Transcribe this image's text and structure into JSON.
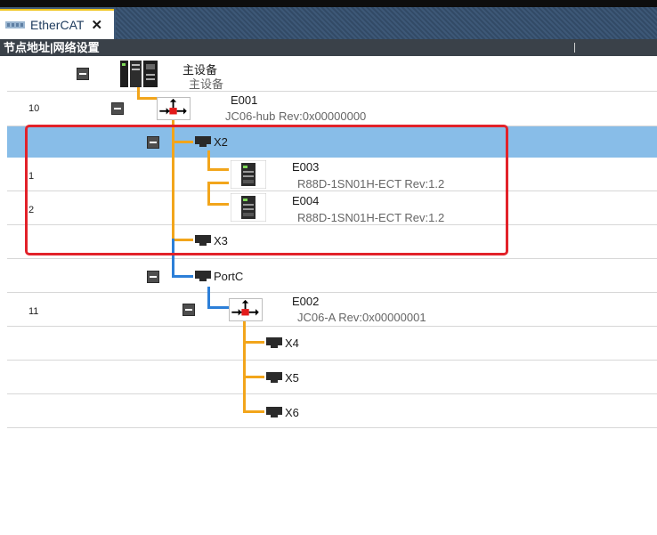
{
  "tab": {
    "title": "EtherCAT",
    "close": "✕"
  },
  "header": {
    "column_label": "节点地址|网络设置"
  },
  "master": {
    "name": "主设备",
    "subtitle": "主设备"
  },
  "nodes": {
    "e001": {
      "address": "10",
      "name": "E001",
      "model": "JC06-hub Rev:0x00000000"
    },
    "e003": {
      "address": "1",
      "name": "E003",
      "model": "R88D-1SN01H-ECT Rev:1.2"
    },
    "e004": {
      "address": "2",
      "name": "E004",
      "model": "R88D-1SN01H-ECT Rev:1.2"
    },
    "e002": {
      "address": "11",
      "name": "E002",
      "model": "JC06-A Rev:0x00000001"
    }
  },
  "ports": {
    "x2": "X2",
    "x3": "X3",
    "portc": "PortC",
    "x4": "X4",
    "x5": "X5",
    "x6": "X6"
  },
  "colors": {
    "line_orange": "#f2a51b",
    "line_blue": "#2c7fd8",
    "selected_row": "#88bde8",
    "highlight_box": "#e2222a",
    "header_bar": "#3a4149",
    "tab_strip": "#3d5877"
  },
  "icons": {
    "tab": "ethercat-network-icon",
    "master": "master-controller-icon",
    "hub": "hub-device-icon",
    "servo": "servo-drive-icon",
    "port": "network-port-icon",
    "collapse": "collapse-minus-icon"
  }
}
